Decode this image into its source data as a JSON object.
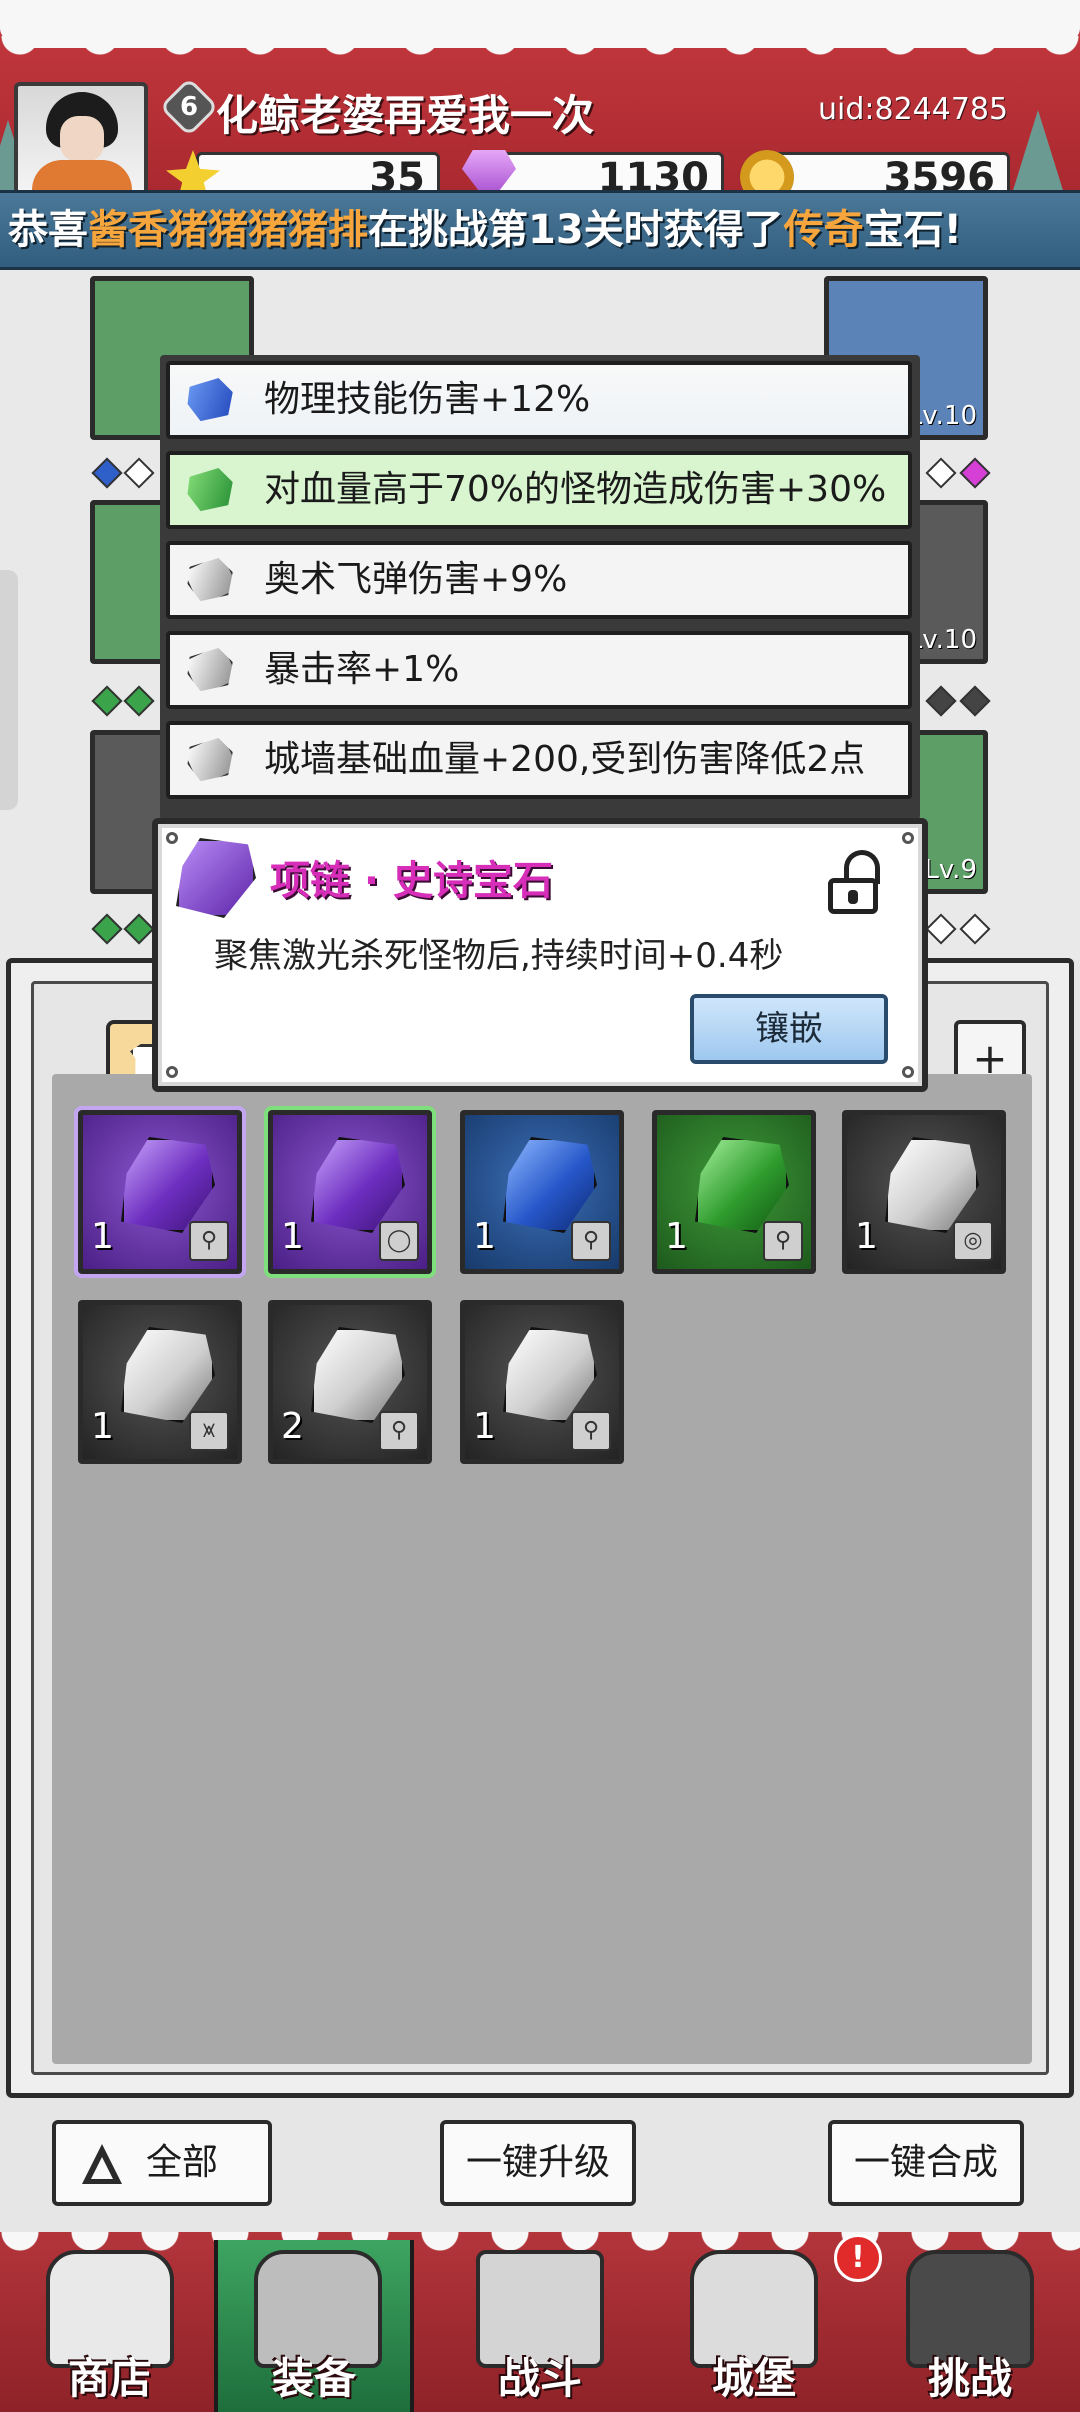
{
  "player": {
    "level": "6",
    "name": "化鲸老婆再爱我一次",
    "uid": "uid:8244785"
  },
  "resources": {
    "stars": "35",
    "gems": "1130",
    "coins": "3596"
  },
  "notice": {
    "prefix": "恭喜",
    "player": "酱香猪猪猪猪排",
    "middle": "在挑战第13关时获得了",
    "rarity": "传奇",
    "suffix": "宝石!"
  },
  "equipment": {
    "slots": [
      {
        "name": "helmet",
        "level": ""
      },
      {
        "name": "weapon",
        "level": "Lv.10"
      },
      {
        "name": "armor",
        "level": ""
      },
      {
        "name": "ring",
        "level": "Lv.10"
      },
      {
        "name": "boots",
        "level": ""
      },
      {
        "name": "necklace",
        "level": "Lv.9"
      }
    ]
  },
  "stat_list": [
    {
      "gem": "blue",
      "text": "物理技能伤害+12%"
    },
    {
      "gem": "green",
      "text": "对血量高于70%的怪物造成伤害+30%"
    },
    {
      "gem": "white",
      "text": "奥术飞弹伤害+9%"
    },
    {
      "gem": "white",
      "text": "暴击率+1%"
    },
    {
      "gem": "white",
      "text": "城墙基础血量+200,受到伤害降低2点"
    }
  ],
  "gem_detail": {
    "title": "项链 · 史诗宝石",
    "description": "聚焦激光杀死怪物后,持续时间+0.4秒",
    "inlay_label": "镶嵌"
  },
  "inventory": {
    "plus_label": "+",
    "items": [
      {
        "color": "purple",
        "count": "1",
        "type": "⚲"
      },
      {
        "color": "purple",
        "count": "1",
        "type": "◯"
      },
      {
        "color": "blue",
        "count": "1",
        "type": "⚲"
      },
      {
        "color": "green",
        "count": "1",
        "type": "⚲"
      },
      {
        "color": "white",
        "count": "1",
        "type": "◎"
      },
      {
        "color": "white",
        "count": "1",
        "type": "⩙"
      },
      {
        "color": "white",
        "count": "2",
        "type": "⚲"
      },
      {
        "color": "white",
        "count": "1",
        "type": "⚲"
      }
    ]
  },
  "buttons": {
    "all": "全部",
    "upgrade_all": "一键升级",
    "merge_all": "一键合成"
  },
  "nav": {
    "shop": "商店",
    "equip": "装备",
    "battle": "战斗",
    "castle": "城堡",
    "challenge": "挑战",
    "badge": "!"
  },
  "colors": {
    "header_red": "#c53a3f",
    "notice_blue": "#4b7898",
    "epic_purple": "#6d2ec0",
    "title_magenta": "#d62eb8",
    "nav_active_green": "#3ea562"
  }
}
